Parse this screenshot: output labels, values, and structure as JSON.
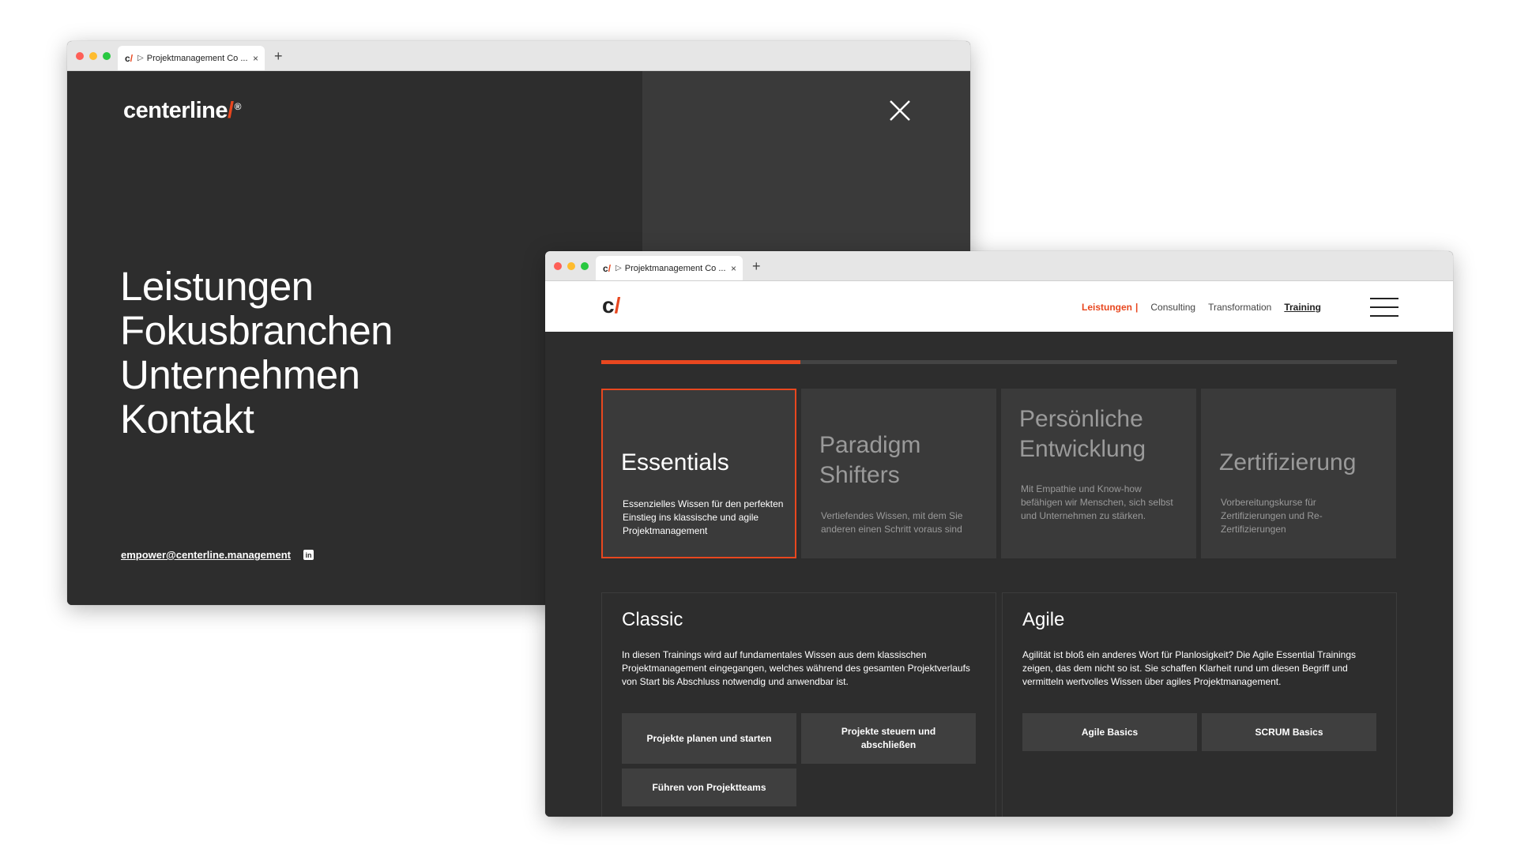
{
  "colors": {
    "accent": "#e8471f",
    "dark_bg": "#2d2d2d",
    "card_bg": "#3a3a3a"
  },
  "back_window": {
    "tab": {
      "favicon": "c/",
      "title": "Projektmanagement Co ...",
      "close": "×",
      "new_tab": "+"
    },
    "logo": {
      "text": "centerline",
      "slash": "/",
      "reg": "®"
    },
    "close_icon": "close-icon",
    "menu": [
      "Leistungen",
      "Fokusbranchen",
      "Unternehmen",
      "Kontakt"
    ],
    "email": "empower@centerline.management",
    "social_icon": "linkedin-icon",
    "social_label": "in"
  },
  "front_window": {
    "tab": {
      "favicon": "c/",
      "title": "Projektmanagement Co ...",
      "close": "×",
      "new_tab": "+"
    },
    "logo": {
      "c": "c",
      "slash": "/"
    },
    "nav": {
      "active": "Leistungen",
      "separator": "|",
      "items": [
        "Consulting",
        "Transformation",
        "Training"
      ]
    },
    "menu_icon": "hamburger-icon",
    "progress": 0.25,
    "cards": [
      {
        "title": "Essentials",
        "desc": "Essenzielles Wissen für den perfekten Einstieg ins klassische und agile Projektmanagement",
        "selected": true
      },
      {
        "title": "Paradigm Shifters",
        "desc": "Vertiefendes Wissen, mit dem Sie anderen einen Schritt voraus sind",
        "selected": false
      },
      {
        "title": "Persönliche Entwicklung",
        "desc": "Mit Empathie und Know-how befähigen wir Menschen, sich selbst und Unternehmen zu stärken.",
        "selected": false
      },
      {
        "title": "Zertifizierung",
        "desc": "Vorbereitungskurse für Zertifizierungen und Re-Zertifizierungen",
        "selected": false
      }
    ],
    "panels": [
      {
        "title": "Classic",
        "text": "In diesen Trainings wird auf fundamentales Wissen aus dem klassischen Projektmanagement eingegangen, welches während des gesamten Projektverlaufs von Start bis Abschluss notwendig und anwendbar ist.",
        "buttons": [
          "Projekte planen und starten",
          "Projekte steuern und abschließen",
          "Führen von Projektteams"
        ]
      },
      {
        "title": "Agile",
        "text": "Agilität ist bloß ein anderes Wort für Planlosigkeit? Die Agile Essential Trainings zeigen, das dem nicht so ist. Sie schaffen Klarheit rund um diesen Begriff und vermitteln wertvolles Wissen über agiles Projektmanagement.",
        "buttons": [
          "Agile Basics",
          "SCRUM Basics"
        ]
      }
    ]
  }
}
